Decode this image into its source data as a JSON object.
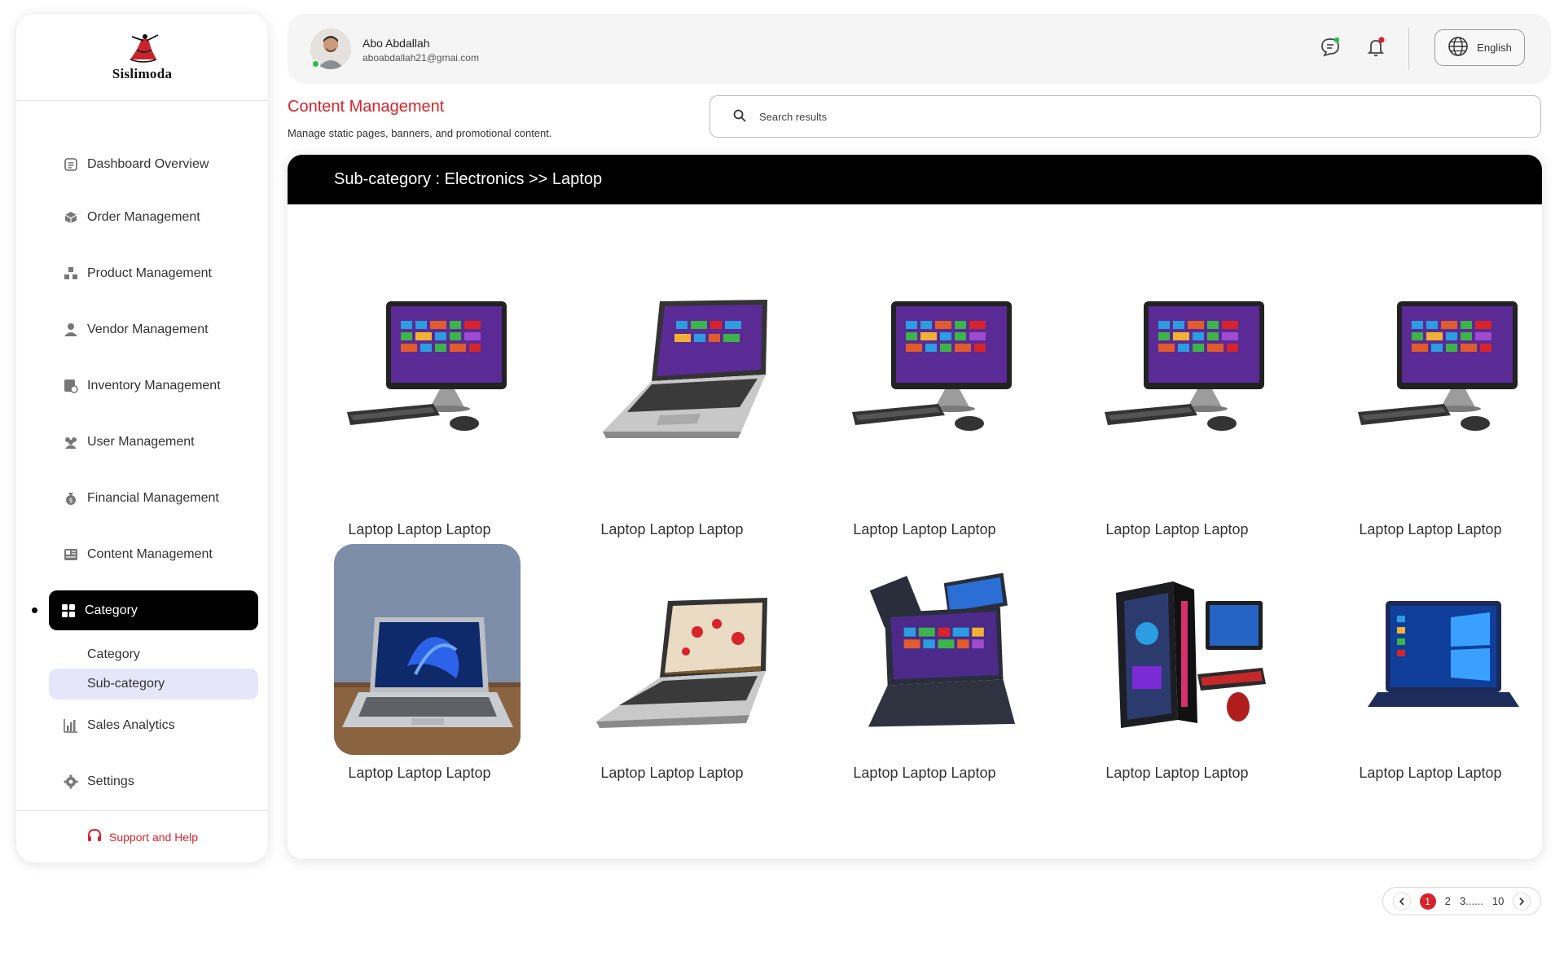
{
  "brand": {
    "name": "Sislimoda"
  },
  "sidebar": {
    "items": [
      {
        "label": "Dashboard Overview",
        "icon": "dashboard-icon"
      },
      {
        "label": "Order Management",
        "icon": "box-icon"
      },
      {
        "label": "Product Management",
        "icon": "boxes-icon"
      },
      {
        "label": "Vendor Management",
        "icon": "vendor-icon"
      },
      {
        "label": "Inventory Management",
        "icon": "inventory-icon"
      },
      {
        "label": "User Management",
        "icon": "users-icon"
      },
      {
        "label": "Financial Management",
        "icon": "money-bag-icon"
      },
      {
        "label": "Content Management",
        "icon": "newspaper-icon"
      },
      {
        "label": "Category",
        "icon": "grid-icon",
        "active": true
      },
      {
        "label": "Sales Analytics",
        "icon": "chart-icon"
      },
      {
        "label": "Settings",
        "icon": "gear-icon"
      }
    ],
    "sub_items": [
      {
        "label": "Category"
      },
      {
        "label": "Sub-category",
        "selected": true
      }
    ],
    "support_label": "Support and Help"
  },
  "header": {
    "user_name": "Abo Abdallah",
    "user_email": "aboabdallah21@gmai.com",
    "language": "English"
  },
  "page": {
    "title": "Content Management",
    "subtitle": "Manage static pages, banners, and promotional content.",
    "search_placeholder": "Search results"
  },
  "main": {
    "header": "Sub-category : Electronics >> Laptop",
    "items": [
      {
        "label": "Laptop Laptop Laptop",
        "image": "all-in-one-pc"
      },
      {
        "label": "Laptop Laptop Laptop",
        "image": "laptop-silver"
      },
      {
        "label": "Laptop Laptop Laptop",
        "image": "all-in-one-pc"
      },
      {
        "label": "Laptop Laptop Laptop",
        "image": "all-in-one-pc"
      },
      {
        "label": "Laptop Laptop Laptop",
        "image": "all-in-one-pc"
      },
      {
        "label": "Laptop Laptop Laptop",
        "image": "laptop-photo"
      },
      {
        "label": "Laptop Laptop Laptop",
        "image": "laptop-flowers"
      },
      {
        "label": "Laptop Laptop Laptop",
        "image": "laptops-stack"
      },
      {
        "label": "Laptop Laptop Laptop",
        "image": "gaming-pc"
      },
      {
        "label": "Laptop Laptop Laptop",
        "image": "laptop-blue"
      }
    ]
  },
  "pagination": {
    "current": "1",
    "pages": [
      "2",
      "3......",
      "10"
    ]
  },
  "colors": {
    "accent": "#d8232a",
    "active_bg": "#000000",
    "selected_sub_bg": "#e6e6fb"
  }
}
